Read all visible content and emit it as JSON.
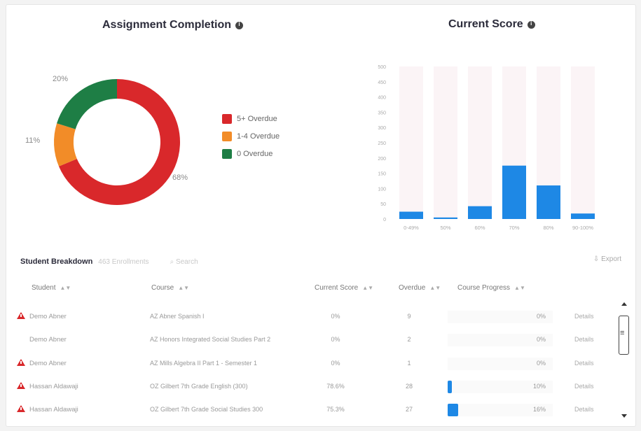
{
  "assignment_completion": {
    "title": "Assignment Completion",
    "labels": {
      "red": "68%",
      "orange": "11%",
      "green": "20%"
    },
    "legend": [
      {
        "label": "5+ Overdue",
        "color": "#d9282b"
      },
      {
        "label": "1-4 Overdue",
        "color": "#f28c28"
      },
      {
        "label": "0 Overdue",
        "color": "#1e7e45"
      }
    ]
  },
  "current_score": {
    "title": "Current Score"
  },
  "chart_data": [
    {
      "type": "pie",
      "title": "Assignment Completion",
      "categories": [
        "5+ Overdue",
        "1-4 Overdue",
        "0 Overdue"
      ],
      "values": [
        68,
        11,
        20
      ],
      "colors": [
        "#d9282b",
        "#f28c28",
        "#1e7e45"
      ],
      "donut": true,
      "legend": "right"
    },
    {
      "type": "bar",
      "title": "Current Score",
      "categories": [
        "0-49%",
        "50%",
        "60%",
        "70%",
        "80%",
        "90-100%"
      ],
      "values": [
        24,
        5,
        42,
        175,
        110,
        18
      ],
      "yticks": [
        "500",
        "450",
        "400",
        "350",
        "300",
        "250",
        "200",
        "150",
        "100",
        "50",
        "0"
      ],
      "ylim": [
        0,
        500
      ],
      "color": "#1e88e5",
      "background_columns": true
    }
  ],
  "breakdown": {
    "title": "Student Breakdown",
    "count": "463 Enrollments",
    "search_placeholder": "Search",
    "export_label": "Export",
    "columns": {
      "student": "Student",
      "course": "Course",
      "score": "Current Score",
      "overdue": "Overdue",
      "progress": "Course Progress"
    },
    "rows": [
      {
        "warning": true,
        "student": "Demo Abner",
        "course": "AZ Abner Spanish I",
        "score": "0%",
        "overdue": "9",
        "progress": 0,
        "progress_label": "0%",
        "details": "Details"
      },
      {
        "warning": false,
        "student": "Demo Abner",
        "course": "AZ Honors Integrated Social Studies Part 2",
        "score": "0%",
        "overdue": "2",
        "progress": 0,
        "progress_label": "0%",
        "details": "Details"
      },
      {
        "warning": true,
        "student": "Demo Abner",
        "course": "AZ Mills Algebra II Part 1 - Semester 1",
        "score": "0%",
        "overdue": "1",
        "progress": 0,
        "progress_label": "0%",
        "details": "Details"
      },
      {
        "warning": true,
        "student": "Hassan Aldawaji",
        "course": "OZ Gilbert 7th Grade English (300)",
        "score": "78.6%",
        "overdue": "28",
        "progress": 0.04,
        "progress_label": "10%",
        "details": "Details"
      },
      {
        "warning": true,
        "student": "Hassan Aldawaji",
        "course": "OZ Gilbert 7th Grade Social Studies 300",
        "score": "75.3%",
        "overdue": "27",
        "progress": 0.1,
        "progress_label": "16%",
        "details": "Details"
      }
    ]
  }
}
